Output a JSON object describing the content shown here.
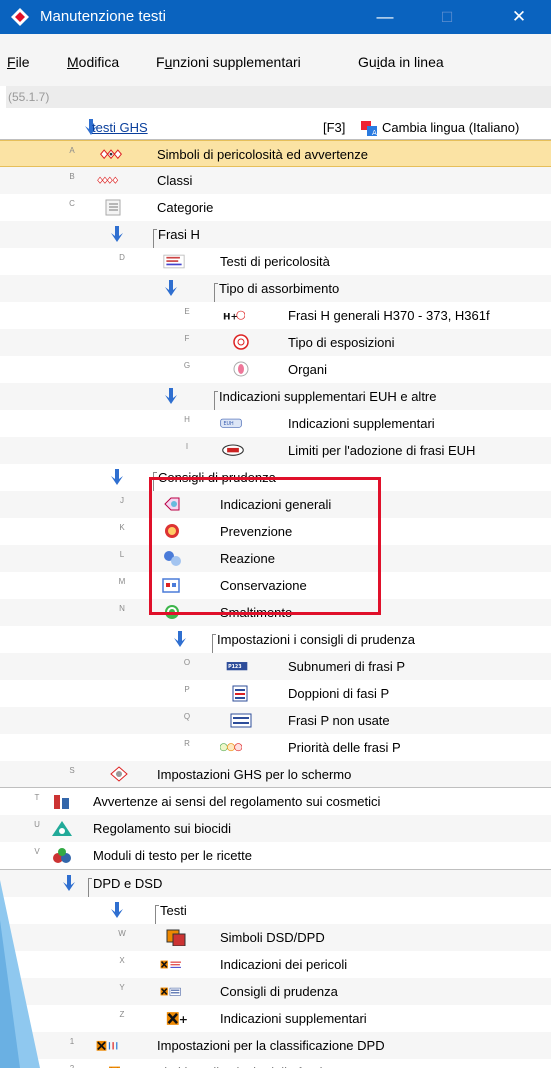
{
  "window": {
    "title": "Manutenzione testi",
    "minimize": "—",
    "maximize": "☐",
    "close": "✕"
  },
  "menu": [
    {
      "label": "File",
      "u": "F",
      "rest": "ile"
    },
    {
      "label": "Modifica",
      "u": "M",
      "rest": "odifica"
    },
    {
      "label": "Funzioni supplementari",
      "pre": "F",
      "u": "u",
      "rest": "nzioni supplementari"
    },
    {
      "label": "Guida in linea",
      "pre": "Gu",
      "u": "i",
      "rest": "da in linea"
    }
  ],
  "version": "(55.1.7)",
  "header": {
    "link": "testi GHS",
    "shortcut": "[F3]",
    "lang_label": "Cambia lingua (Italiano)"
  },
  "tree": [
    {
      "key": "A",
      "label": "Simboli di pericolosità ed avvertenze",
      "icon": "ghs-pictograms-icon",
      "selected": true
    },
    {
      "key": "B",
      "label": "Classi",
      "icon": "classes-icon"
    },
    {
      "key": "C",
      "label": "Categorie",
      "icon": "categories-icon"
    },
    {
      "label": "Frasi H"
    },
    {
      "key": "D",
      "label": "Testi di pericolosità",
      "icon": "hazard-texts-icon"
    },
    {
      "label": "Tipo di assorbimento"
    },
    {
      "key": "E",
      "label": "Frasi H generali H370 - 373, H361f",
      "icon": "h-plus-organs-icon"
    },
    {
      "key": "F",
      "label": "Tipo di esposizioni",
      "icon": "exposure-icon"
    },
    {
      "key": "G",
      "label": "Organi",
      "icon": "organs-icon"
    },
    {
      "label": "Indicazioni supplementari EUH e altre"
    },
    {
      "key": "H",
      "label": "Indicazioni supplementari",
      "icon": "euh-supplementary-icon"
    },
    {
      "key": "I",
      "label": "Limiti per l'adozione di frasi EUH",
      "icon": "euh-limits-icon"
    },
    {
      "label": "Consigli di prudenza"
    },
    {
      "key": "J",
      "label": "Indicazioni generali",
      "icon": "general-precaution-icon"
    },
    {
      "key": "K",
      "label": "Prevenzione",
      "icon": "prevention-icon"
    },
    {
      "key": "L",
      "label": "Reazione",
      "icon": "reaction-icon"
    },
    {
      "key": "M",
      "label": "Conservazione",
      "icon": "storage-icon"
    },
    {
      "key": "N",
      "label": "Smaltimento",
      "icon": "disposal-icon"
    },
    {
      "label": "Impostazioni i consigli di prudenza"
    },
    {
      "key": "O",
      "label": "Subnumeri di frasi P",
      "icon": "p-subnumbers-icon"
    },
    {
      "key": "P",
      "label": "Doppioni di fasi P",
      "icon": "p-duplicates-icon"
    },
    {
      "key": "Q",
      "label": "Frasi P non usate",
      "icon": "p-unused-icon"
    },
    {
      "key": "R",
      "label": "Priorità delle frasi P",
      "icon": "p-priority-icon"
    },
    {
      "key": "S",
      "label": "Impostazioni GHS per lo schermo",
      "icon": "ghs-screen-settings-icon"
    },
    {
      "key": "T",
      "label": "Avvertenze ai sensi del regolamento sui cosmetici",
      "icon": "cosmetics-icon"
    },
    {
      "key": "U",
      "label": "Regolamento sui biocidi",
      "icon": "biocides-icon"
    },
    {
      "key": "V",
      "label": "Moduli di testo per le ricette",
      "icon": "recipe-modules-icon"
    },
    {
      "label": "DPD e DSD"
    },
    {
      "label": "Testi"
    },
    {
      "key": "W",
      "label": "Simboli DSD/DPD",
      "icon": "dsd-symbols-icon"
    },
    {
      "key": "X",
      "label": "Indicazioni dei pericoli",
      "icon": "danger-indications-icon"
    },
    {
      "key": "Y",
      "label": "Consigli di prudenza",
      "icon": "dsd-precaution-icon"
    },
    {
      "key": "Z",
      "label": "Indicazioni supplementari",
      "icon": "dsd-supplementary-icon"
    },
    {
      "key": "1",
      "label": "Impostazioni per la classificazione DPD",
      "icon": "dpd-classification-icon"
    },
    {
      "key": "2",
      "label": "Limiti per il calcolo delle frasi R e S",
      "icon": "rs-limits-icon"
    }
  ]
}
